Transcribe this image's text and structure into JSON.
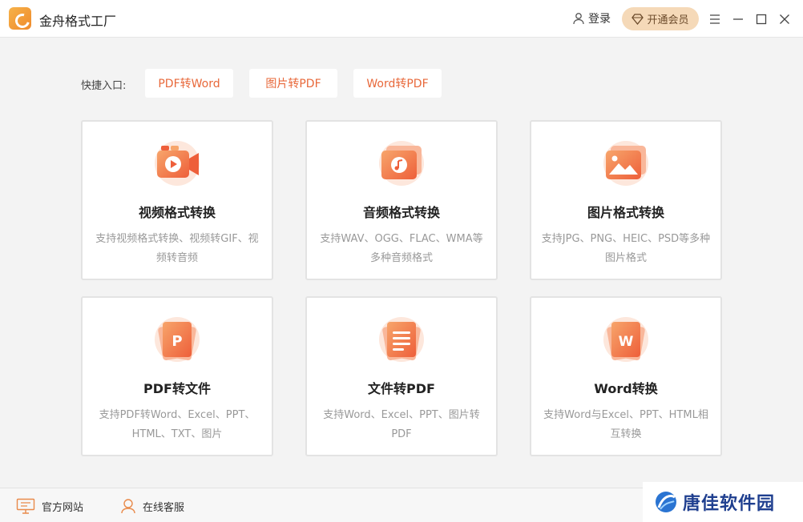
{
  "app": {
    "title": "金舟格式工厂"
  },
  "header": {
    "login_label": "登录",
    "vip_label": "开通会员"
  },
  "quick_entry": {
    "label": "快捷入口:",
    "items": [
      "PDF转Word",
      "图片转PDF",
      "Word转PDF"
    ]
  },
  "cards": [
    {
      "title": "视频格式转换",
      "desc": "支持视频格式转换、视频转GIF、视频转音频",
      "icon": "video-icon"
    },
    {
      "title": "音频格式转换",
      "desc": "支持WAV、OGG、FLAC、WMA等多种音频格式",
      "icon": "music-icon"
    },
    {
      "title": "图片格式转换",
      "desc": "支持JPG、PNG、HEIC、PSD等多种图片格式",
      "icon": "image-icon"
    },
    {
      "title": "PDF转文件",
      "desc": "支持PDF转Word、Excel、PPT、HTML、TXT、图片",
      "icon": "pdf-p-icon"
    },
    {
      "title": "文件转PDF",
      "desc": "支持Word、Excel、PPT、图片转PDF",
      "icon": "document-icon"
    },
    {
      "title": "Word转换",
      "desc": "支持Word与Excel、PPT、HTML相互转换",
      "icon": "word-w-icon"
    }
  ],
  "footer": {
    "website_label": "官方网站",
    "service_label": "在线客服"
  },
  "watermark": {
    "text": "唐佳软件园"
  },
  "colors": {
    "accent": "#e8683a",
    "vip_bg": "#f5d9b8",
    "icon_gradient": [
      "#f7a56b",
      "#ee5f3a"
    ]
  }
}
